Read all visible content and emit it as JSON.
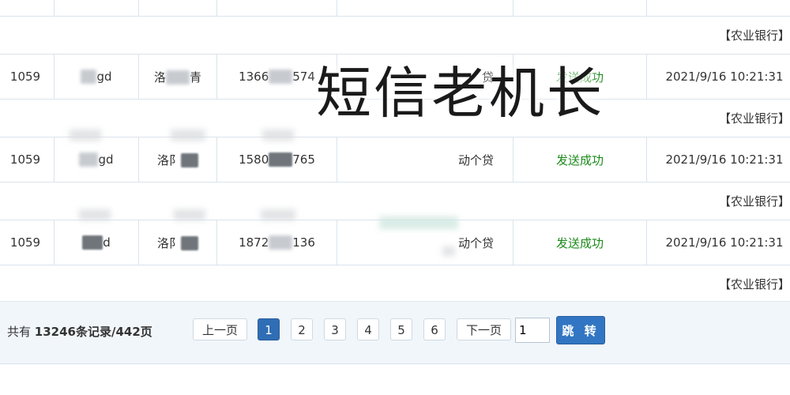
{
  "watermark": "短信老机长",
  "rows": [
    {
      "id": "1059",
      "user_suffix": "gd",
      "name_prefix": "洛",
      "name_suffix": "青",
      "phone_prefix": "1366",
      "phone_suffix": "574",
      "product_suffix": "贷",
      "status": "发送成功",
      "time": "2021/9/16 10:21:31",
      "message": "【农业银行】尊"
    },
    {
      "id": "1059",
      "user_suffix": "gd",
      "name_prefix": "洛阝",
      "name_suffix": "",
      "phone_prefix": "1580",
      "phone_suffix": "765",
      "product_suffix": "动个贷",
      "status": "发送成功",
      "time": "2021/9/16 10:21:31",
      "message": "【农业银行】尊"
    },
    {
      "id": "1059",
      "user_suffix": "d",
      "name_prefix": "洛阝",
      "name_suffix": "",
      "phone_prefix": "1872",
      "phone_suffix": "136",
      "product_suffix": "动个贷",
      "status": "发送成功",
      "time": "2021/9/16 10:21:31",
      "message": "【农业银行】尊"
    }
  ],
  "top_message": "【农业银行】尊",
  "pager": {
    "total_prefix": "共有",
    "total_value": "13246条记录/442页",
    "prev": "上一页",
    "pages": [
      "1",
      "2",
      "3",
      "4",
      "5",
      "6"
    ],
    "active_page": "1",
    "next": "下一页",
    "jump_value": "1",
    "jump_label": "跳 转"
  },
  "colors": {
    "status": "#1b8a1b",
    "active_page": "#2f6db5",
    "jump_button": "#3276c3"
  }
}
